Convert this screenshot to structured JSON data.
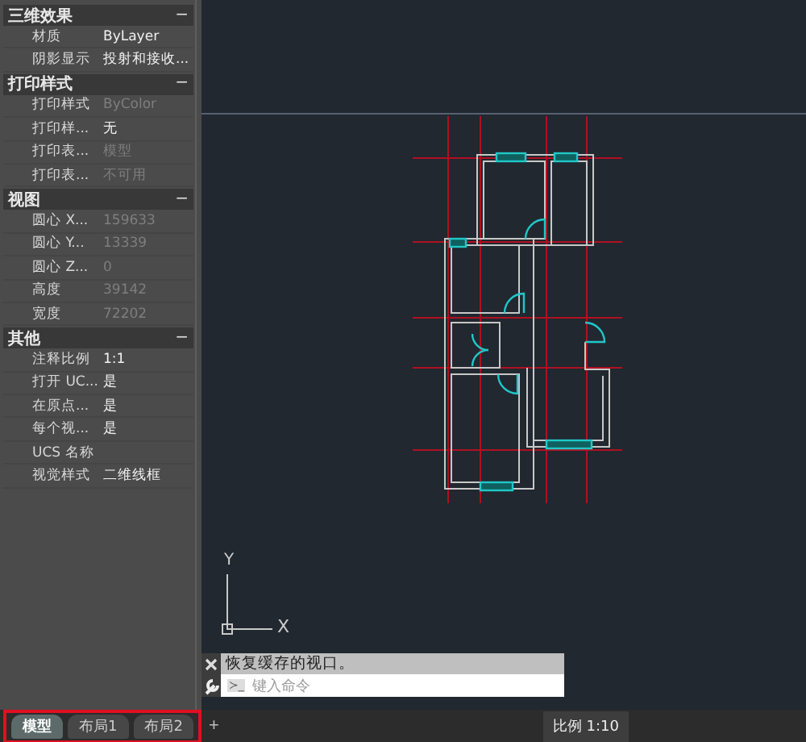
{
  "properties": {
    "sections": [
      {
        "title": "三维效果",
        "collapse_symbol": "−",
        "rows": [
          {
            "label": "材质",
            "value": "ByLayer",
            "disabled": false
          },
          {
            "label": "阴影显示",
            "value": "投射和接收...",
            "disabled": false
          }
        ]
      },
      {
        "title": "打印样式",
        "collapse_symbol": "−",
        "rows": [
          {
            "label": "打印样式",
            "value": "ByColor",
            "disabled": true
          },
          {
            "label": "打印样...",
            "value": "无",
            "disabled": false
          },
          {
            "label": "打印表...",
            "value": "模型",
            "disabled": true
          },
          {
            "label": "打印表...",
            "value": "不可用",
            "disabled": true
          }
        ]
      },
      {
        "title": "视图",
        "collapse_symbol": "−",
        "rows": [
          {
            "label": "圆心 X...",
            "value": "159633",
            "disabled": true
          },
          {
            "label": "圆心 Y...",
            "value": "13339",
            "disabled": true
          },
          {
            "label": "圆心 Z...",
            "value": "0",
            "disabled": true
          },
          {
            "label": "高度",
            "value": "39142",
            "disabled": true
          },
          {
            "label": "宽度",
            "value": "72202",
            "disabled": true
          }
        ]
      },
      {
        "title": "其他",
        "collapse_symbol": "−",
        "rows": [
          {
            "label": "注释比例",
            "value": "1:1",
            "disabled": false
          },
          {
            "label": "打开 UC...",
            "value": "是",
            "disabled": false
          },
          {
            "label": "在原点...",
            "value": "是",
            "disabled": false
          },
          {
            "label": "每个视...",
            "value": "是",
            "disabled": false
          },
          {
            "label": "UCS 名称"
          },
          {
            "label": "视觉样式",
            "value": "二维线框",
            "disabled": false
          }
        ]
      }
    ]
  },
  "viewport": {
    "ucs_x": "X",
    "ucs_y": "Y"
  },
  "command_line": {
    "history": "恢复缓存的视口。",
    "prompt": "≻_",
    "placeholder": "键入命令"
  },
  "layout_tabs": [
    {
      "label": "模型",
      "selected": true
    },
    {
      "label": "布局1",
      "selected": false
    },
    {
      "label": "布局2",
      "selected": false
    }
  ],
  "add_tab": "+",
  "status_bar": {
    "scale": "比例 1:10"
  }
}
